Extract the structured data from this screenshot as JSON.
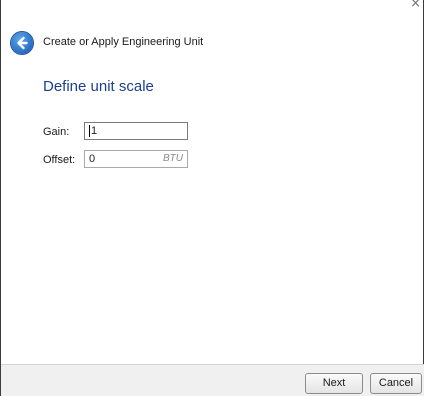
{
  "window": {
    "close_glyph": "×"
  },
  "header": {
    "back_icon": "back-arrow-icon",
    "title": "Create or Apply Engineering Unit"
  },
  "page": {
    "heading": "Define unit scale"
  },
  "form": {
    "gain": {
      "label": "Gain:",
      "value": "1"
    },
    "offset": {
      "label": "Offset:",
      "value": "0",
      "unit": "BTU"
    }
  },
  "footer": {
    "next_label": "Next",
    "cancel_label": "Cancel"
  },
  "colors": {
    "heading": "#1c3f8f",
    "back_button": "#2f74c8",
    "footer_bg": "#f0f0f0"
  }
}
